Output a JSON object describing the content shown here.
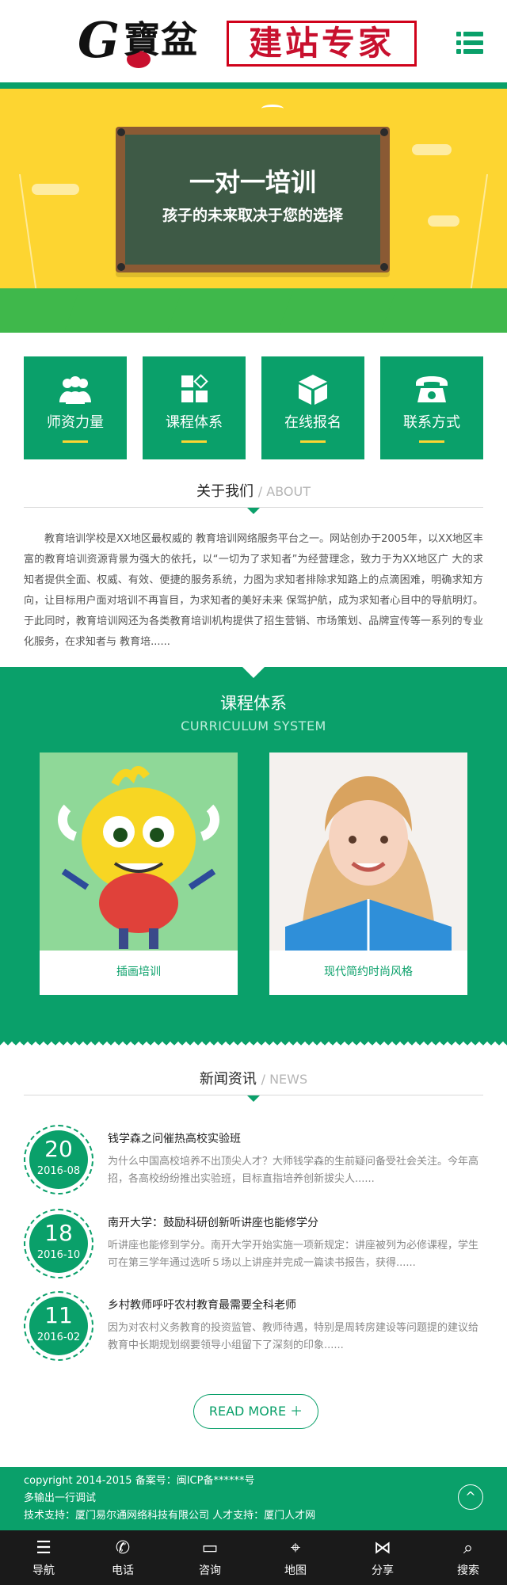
{
  "header": {
    "logo_g": "G",
    "logo_brand": "寶盆",
    "logo_tagline": "建站专家",
    "menu_icon": "menu-list-icon"
  },
  "banner": {
    "title": "一对一培训",
    "subtitle": "孩子的未来取决于您的选择"
  },
  "quick_links": [
    {
      "label": "师资力量",
      "icon": "teachers-icon"
    },
    {
      "label": "课程体系",
      "icon": "grid-icon"
    },
    {
      "label": "在线报名",
      "icon": "cube-icon"
    },
    {
      "label": "联系方式",
      "icon": "phone-icon"
    }
  ],
  "about": {
    "title": "关于我们",
    "title_en": "/ ABOUT",
    "text": "教育培训学校是XX地区最权威的 教育培训网络服务平台之一。网站创办于2005年，以XX地区丰富的教育培训资源背景为强大的依托，以“一切为了求知者”为经营理念，致力于为XX地区广 大的求知者提供全面、权威、有效、便捷的服务系统，力图为求知者排除求知路上的点滴困难，明确求知方向，让目标用户面对培训不再盲目，为求知者的美好未来 保驾护航，成为求知者心目中的导航明灯。于此同时，教育培训网还为各类教育培训机构提供了招生营销、市场策划、品牌宣传等一系列的专业化服务，在求知者与 教育培......"
  },
  "curriculum": {
    "title": "课程体系",
    "title_en": "CURRICULUM SYSTEM",
    "cards": [
      {
        "caption": "插画培训"
      },
      {
        "caption": "现代简约时尚风格"
      }
    ]
  },
  "news": {
    "title": "新闻资讯",
    "title_en": "/ NEWS",
    "items": [
      {
        "day": "20",
        "ym": "2016-08",
        "title": "钱学森之问催热高校实验班",
        "desc": "为什么中国高校培养不出顶尖人才？大师钱学森的生前疑问备受社会关注。今年高招，各高校纷纷推出实验班，目标直指培养创新拔尖人......"
      },
      {
        "day": "18",
        "ym": "2016-10",
        "title": "南开大学：鼓励科研创新听讲座也能修学分",
        "desc": "听讲座也能修到学分。南开大学开始实施一项新规定：讲座被列为必修课程，学生可在第三学年通过选听５场以上讲座并完成一篇读书报告，获得......"
      },
      {
        "day": "11",
        "ym": "2016-02",
        "title": "乡村教师呼吁农村教育最需要全科老师",
        "desc": "因为对农村义务教育的投资监管、教师待遇，特别是周转房建设等问题提的建议给教育中长期规划纲要领导小组留下了深刻的印象......"
      }
    ],
    "more": "READ MORE ＋"
  },
  "footer": {
    "line1": "copyright 2014-2015 备案号：闽ICP备******号",
    "line2": "多输出一行调试",
    "line3": "技术支持：厦门易尔通网络科技有限公司 人才支持：厦门人才网",
    "to_top": "^"
  },
  "bottom_nav": [
    {
      "label": "导航",
      "icon": "list-icon",
      "glyph": "☰"
    },
    {
      "label": "电话",
      "icon": "phone-icon",
      "glyph": "✆"
    },
    {
      "label": "咨询",
      "icon": "chat-icon",
      "glyph": "▭"
    },
    {
      "label": "地图",
      "icon": "map-icon",
      "glyph": "⌖"
    },
    {
      "label": "分享",
      "icon": "share-icon",
      "glyph": "⋈"
    },
    {
      "label": "搜索",
      "icon": "search-icon",
      "glyph": "⌕"
    }
  ],
  "colors": {
    "brand_green": "#0aa06a",
    "banner_yellow": "#fdd531",
    "logo_red": "#c8102e",
    "accent_underline": "#fdd531",
    "bottom_nav_bg": "#1a1a1a"
  }
}
